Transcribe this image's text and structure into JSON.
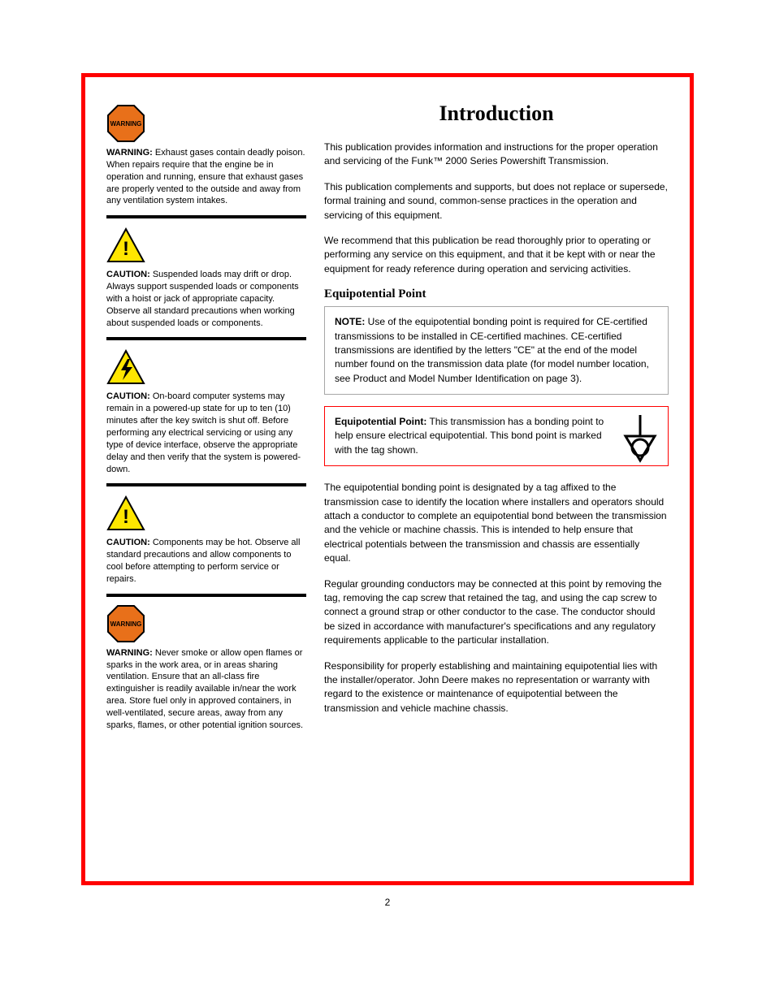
{
  "page_number": "2",
  "left": {
    "blocks": [
      {
        "icon": "warning-octagon",
        "lead": "WARNING:",
        "text": " Exhaust gases contain deadly poison. When repairs require that the engine be in operation and running, ensure that exhaust gases are properly vented to the outside and away from any ventilation system intakes."
      },
      {
        "icon": "caution-triangle-bang",
        "lead": "CAUTION:",
        "text": " Suspended loads may drift or drop. Always support suspended loads or components with a hoist or jack of appropriate capacity. Observe all standard precautions when working about suspended loads or components."
      },
      {
        "icon": "caution-triangle-bolt",
        "lead": "CAUTION:",
        "text": " On-board computer systems may remain in a powered-up state for up to ten (10) minutes after the key switch is shut off. Before performing any electrical servicing or using any type of device interface, observe the appropriate delay and then verify that the system is powered-down."
      },
      {
        "icon": "caution-triangle-bang",
        "lead": "CAUTION:",
        "text": " Components may be hot. Observe all standard precautions and allow components to cool before attempting to perform service or repairs."
      },
      {
        "icon": "warning-octagon",
        "lead": "WARNING:",
        "text": " Never smoke or allow open flames or sparks in the work area, or in areas sharing ventilation. Ensure that an all-class fire extinguisher is readily available in/near the work area. Store fuel only in approved containers, in well-ventilated, secure areas, away from any sparks, flames, or other potential ignition sources."
      }
    ]
  },
  "right": {
    "heading": "Introduction",
    "paragraphs_top": [
      "This publication provides information and instructions for the proper operation and servicing of the Funk™ 2000 Series Powershift Transmission.",
      "This publication complements and supports, but does not replace or supersede, formal training and sound, common-sense practices in the operation and servicing of this equipment.",
      "We recommend that this publication be read thoroughly prior to operating or performing any service on this equipment, and that it be kept with or near the equipment for ready reference during operation and servicing activities."
    ],
    "sub_heading": "Equipotential Point",
    "note_box": {
      "lead": "NOTE:",
      "text": " Use of the equipotential bonding point is required for CE-certified transmissions to be installed in CE-certified machines. CE-certified transmissions are identified by the letters \"CE\" at the end of the model number found on the transmission data plate (for model number location, see Product and Model Number Identification on page 3)."
    },
    "red_box": {
      "bold": "Equipotential Point:",
      "text": " This transmission has a bonding point to help ensure electrical equipotential. This bond point is marked with the tag shown.",
      "icon": "equipotential-icon"
    },
    "paragraphs_bottom": [
      "The equipotential bonding point is designated by a tag affixed to the transmission case to identify the location where installers and operators should attach a conductor to complete an equipotential bond between the transmission and the vehicle or machine chassis. This is intended to help ensure that electrical potentials between the transmission and chassis are essentially equal.",
      "Regular grounding conductors may be connected at this point by removing the tag, removing the cap screw that retained the tag, and using the cap screw to connect a ground strap or other conductor to the case. The conductor should be sized in accordance with manufacturer's specifications and any regulatory requirements applicable to the particular installation.",
      "Responsibility for properly establishing and maintaining equipotential lies with the installer/operator. John Deere makes no representation or warranty with regard to the existence or maintenance of equipotential between the transmission and vehicle machine chassis."
    ]
  }
}
